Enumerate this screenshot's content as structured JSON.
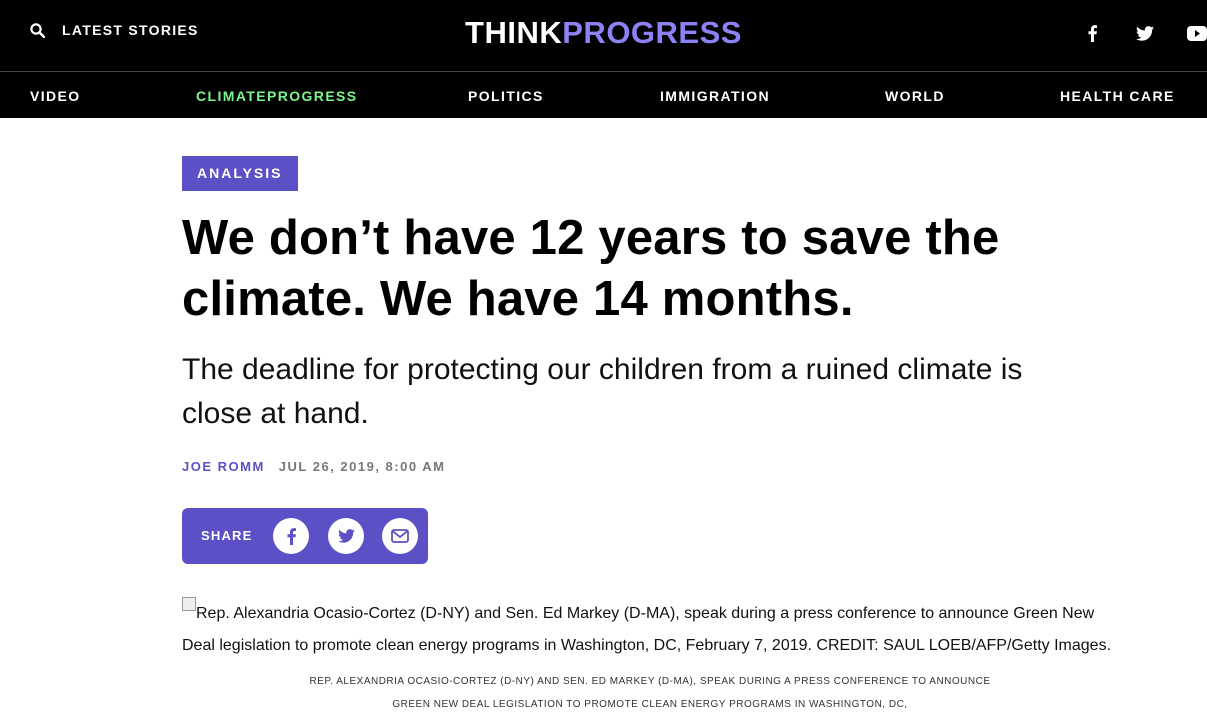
{
  "header": {
    "latest_label": "LATEST STORIES",
    "logo_think": "THINK",
    "logo_progress": "PROGRESS",
    "colors": {
      "bar": "#000000",
      "accent": "#8d82f5",
      "climate_green": "#7ef58b"
    },
    "social_icons": [
      "facebook-icon",
      "twitter-icon",
      "youtube-icon"
    ]
  },
  "nav": {
    "items": [
      {
        "label": "VIDEO"
      },
      {
        "label": "CLIMATEPROGRESS"
      },
      {
        "label": "POLITICS"
      },
      {
        "label": "IMMIGRATION"
      },
      {
        "label": "WORLD"
      },
      {
        "label": "HEALTH CARE"
      }
    ]
  },
  "article": {
    "badge": "ANALYSIS",
    "headline": "We don’t have 12 years to save the climate. We have 14 months.",
    "dek": "The deadline for protecting our children from a ruined climate is close at hand.",
    "author": "JOE ROMM",
    "date": "JUL 26, 2019, 8:00 AM",
    "share": {
      "label": "SHARE",
      "buttons": [
        "facebook-icon",
        "twitter-icon",
        "email-icon"
      ]
    },
    "image_alt": "Rep. Alexandria Ocasio-Cortez (D-NY) and Sen. Ed Markey (D-MA), speak during a press conference to announce Green New Deal legislation to promote clean energy programs in Washington, DC, February 7, 2019. CREDIT: SAUL LOEB/AFP/Getty Images.",
    "caption": "REP. ALEXANDRIA OCASIO-CORTEZ (D-NY) AND SEN. ED MARKEY (D-MA), SPEAK DURING A PRESS CONFERENCE TO ANNOUNCE GREEN NEW DEAL LEGISLATION TO PROMOTE CLEAN ENERGY PROGRAMS IN WASHINGTON, DC,"
  }
}
